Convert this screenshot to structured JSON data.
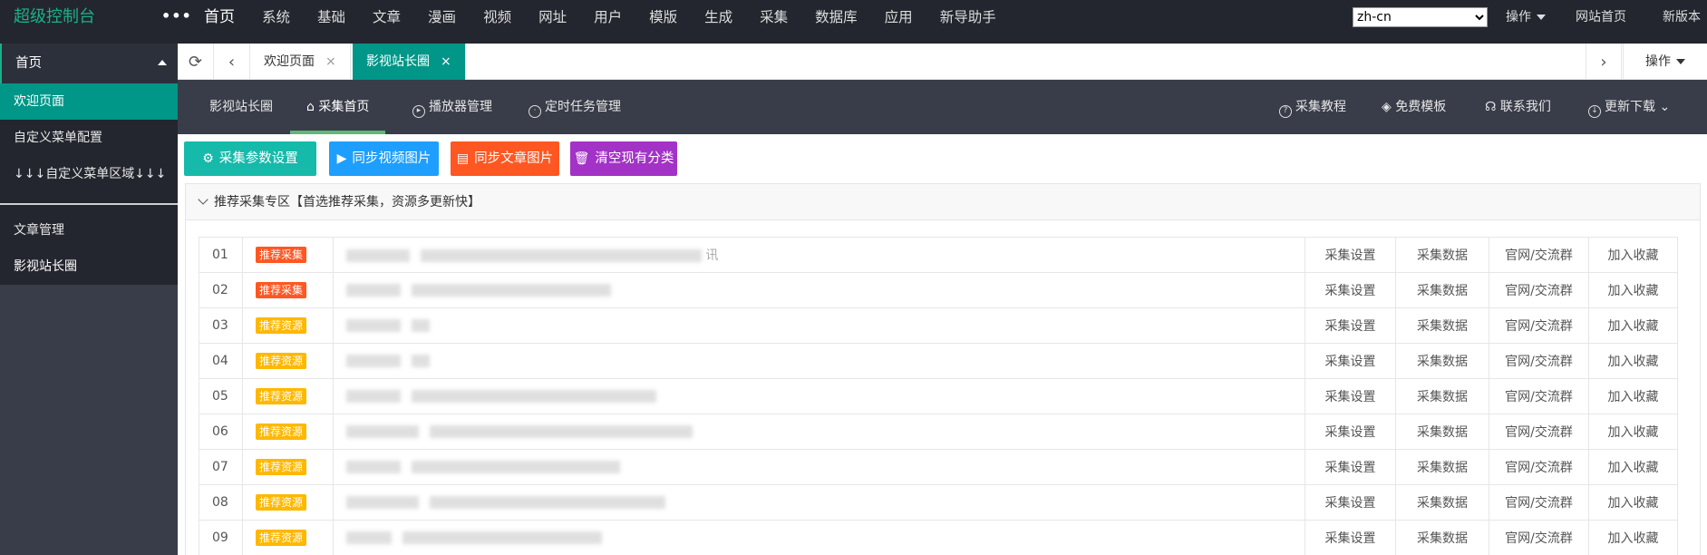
{
  "header": {
    "brand": "超级控制台",
    "more": "•••",
    "nav": [
      "首页",
      "系统",
      "基础",
      "文章",
      "漫画",
      "视频",
      "网址",
      "用户",
      "模版",
      "生成",
      "采集",
      "数据库",
      "应用",
      "新导助手"
    ],
    "lang_value": "zh-cn",
    "ops_label": "操作",
    "site_home": "网站首页",
    "new_version": "新版本"
  },
  "sidebar": {
    "head": "首页",
    "items": [
      "欢迎页面",
      "自定义菜单配置",
      "↓↓↓自定义菜单区域↓↓↓"
    ],
    "items2": [
      "文章管理",
      "影视站长圈"
    ]
  },
  "tabs": {
    "refresh": "⟳",
    "prev": "‹",
    "next": "›",
    "list": [
      {
        "label": "欢迎页面",
        "close": "×"
      },
      {
        "label": "影视站长圈",
        "close": "×"
      }
    ],
    "ops_label": "操作"
  },
  "subnav": {
    "items": [
      "影视站长圈",
      "采集首页",
      "播放器管理",
      "定时任务管理"
    ],
    "right": [
      "采集教程",
      "免费模板",
      "联系我们",
      "更新下载"
    ]
  },
  "buttons": [
    {
      "label": "采集参数设置",
      "color": "#16baaa",
      "icon": "⚙"
    },
    {
      "label": "同步视频图片",
      "color": "#1e9fff",
      "icon": "▶"
    },
    {
      "label": "同步文章图片",
      "color": "#ff5722",
      "icon": "▤"
    },
    {
      "label": "清空现有分类",
      "color": "#a233c6",
      "icon": "🗑"
    }
  ],
  "panel": {
    "title": "推荐采集专区【首选推荐采集，资源多更新快】"
  },
  "rows": [
    {
      "num": "01",
      "tag": "推荐采集",
      "tag_color": "red",
      "desc": "讯"
    },
    {
      "num": "02",
      "tag": "推荐采集",
      "tag_color": "red",
      "desc": ""
    },
    {
      "num": "03",
      "tag": "推荐资源",
      "tag_color": "orange",
      "desc": ""
    },
    {
      "num": "04",
      "tag": "推荐资源",
      "tag_color": "orange",
      "desc": ""
    },
    {
      "num": "05",
      "tag": "推荐资源",
      "tag_color": "orange",
      "desc": ""
    },
    {
      "num": "06",
      "tag": "推荐资源",
      "tag_color": "orange",
      "desc": ""
    },
    {
      "num": "07",
      "tag": "推荐资源",
      "tag_color": "orange",
      "desc": ""
    },
    {
      "num": "08",
      "tag": "推荐资源",
      "tag_color": "orange",
      "desc": ""
    },
    {
      "num": "09",
      "tag": "推荐资源",
      "tag_color": "orange",
      "desc": ""
    }
  ],
  "row_actions": [
    "采集设置",
    "采集数据",
    "官网/交流群",
    "加入收藏"
  ],
  "colors": {
    "accent": "#009688",
    "brand": "#18b188",
    "dark": "#23262e",
    "side": "#393d49"
  }
}
